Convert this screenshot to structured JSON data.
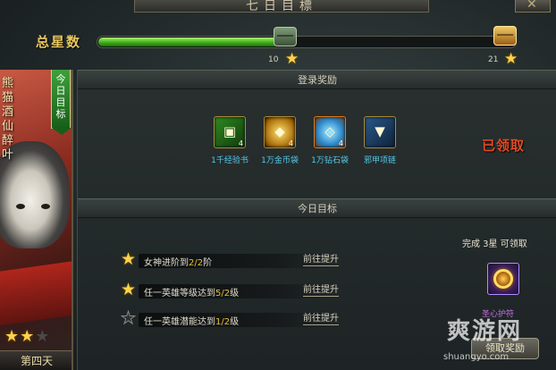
{
  "window": {
    "title": "七日目標",
    "close_icon": "close-icon"
  },
  "star_total": {
    "label": "总星数",
    "progress": 0.43,
    "milestones": [
      {
        "value": "10",
        "chest": "green-chest"
      },
      {
        "value": "21",
        "chest": "gold-chest"
      }
    ]
  },
  "hero": {
    "name": "熊猫酒仙醉叶",
    "tag": "今日目标",
    "stars_earned": 2,
    "stars_total": 3,
    "day_label": "第四天"
  },
  "login_reward": {
    "header": "登录奖励",
    "items": [
      {
        "name": "1千经验书",
        "count": "4",
        "icon": "exp-book-icon"
      },
      {
        "name": "1万金币袋",
        "count": "4",
        "icon": "gold-bag-icon"
      },
      {
        "name": "1万钻石袋",
        "count": "4",
        "icon": "diamond-bag-icon"
      },
      {
        "name": "邪甲项链",
        "count": "",
        "icon": "necklace-icon"
      }
    ],
    "status": "已领取"
  },
  "today_goal": {
    "header": "今日目标",
    "tasks": [
      {
        "text_prefix": "女神进阶到",
        "progress": "2/2",
        "text_suffix": "阶",
        "star": true,
        "action": "前往提升"
      },
      {
        "text_prefix": "任一英雄等级达到",
        "progress": "5/2",
        "text_suffix": "级",
        "star": true,
        "action": "前往提升"
      },
      {
        "text_prefix": "任一英雄潜能达到",
        "progress": "1/2",
        "text_suffix": "级",
        "star": false,
        "action": "前往提升"
      }
    ],
    "claim_text": "完成 3星 可领取",
    "reward_name": "圣心护符",
    "claim_button": "领取奖励"
  },
  "watermark": {
    "big": "爽游网",
    "small": "shuangyo.com"
  },
  "colors": {
    "progress_green": "#3fae1a",
    "star_gold": "#ffd24a",
    "claimed_red": "#e24a22",
    "reward_name_blue": "#54c9e8"
  }
}
